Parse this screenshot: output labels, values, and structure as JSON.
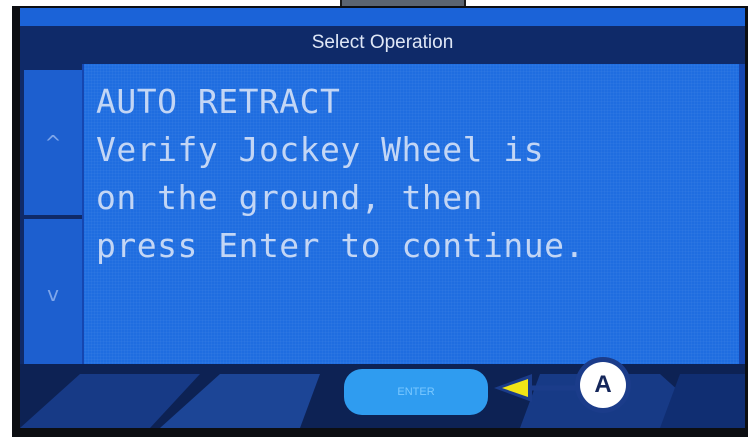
{
  "screen": {
    "title": "Select Operation",
    "message_lines": [
      "AUTO RETRACT",
      "Verify Jockey Wheel is",
      "on the ground, then",
      "press Enter to continue."
    ]
  },
  "nav": {
    "up_symbol": "^",
    "down_symbol": "v"
  },
  "actions": {
    "enter_label": "ENTER"
  },
  "callout": {
    "label": "A",
    "color": "#1b3c8a",
    "arrow_color": "#f2e516"
  },
  "colors": {
    "screen_bg": "#1546b0",
    "message_bg": "#1f6de0",
    "title_bar": "#0f2a69",
    "enter_button": "#2f9cf0",
    "bezel": "#0c0e12"
  }
}
